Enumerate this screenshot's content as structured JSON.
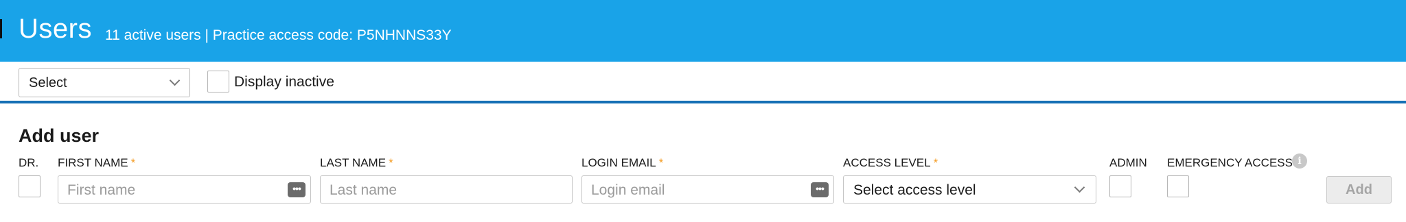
{
  "header": {
    "title": "Users",
    "subtitle": "11 active users | Practice access code: P5NHNNS33Y"
  },
  "toolbar": {
    "select_value": "Select",
    "display_inactive_label": "Display inactive",
    "display_inactive_checked": false
  },
  "add_user": {
    "title": "Add user",
    "columns": {
      "dr": "DR.",
      "first_name": "FIRST NAME",
      "last_name": "LAST NAME",
      "login_email": "LOGIN EMAIL",
      "access_level": "ACCESS LEVEL",
      "admin": "ADMIN",
      "emergency_access": "EMERGENCY ACCESS"
    },
    "required_marker": "*",
    "placeholders": {
      "first_name": "First name",
      "last_name": "Last name",
      "login_email": "Login email"
    },
    "access_level_value": "Select access level",
    "add_button": "Add",
    "password_icon_glyph": "•••",
    "info_icon_glyph": "i"
  },
  "colors": {
    "header_bg": "#19a3e8",
    "divider": "#1670b5",
    "required": "#f39a1f",
    "button_disabled_bg": "#ececec"
  },
  "icons": {
    "select_chevron": "chevron-down-icon",
    "password_manager": "password-manager-icon",
    "info": "info-icon"
  }
}
